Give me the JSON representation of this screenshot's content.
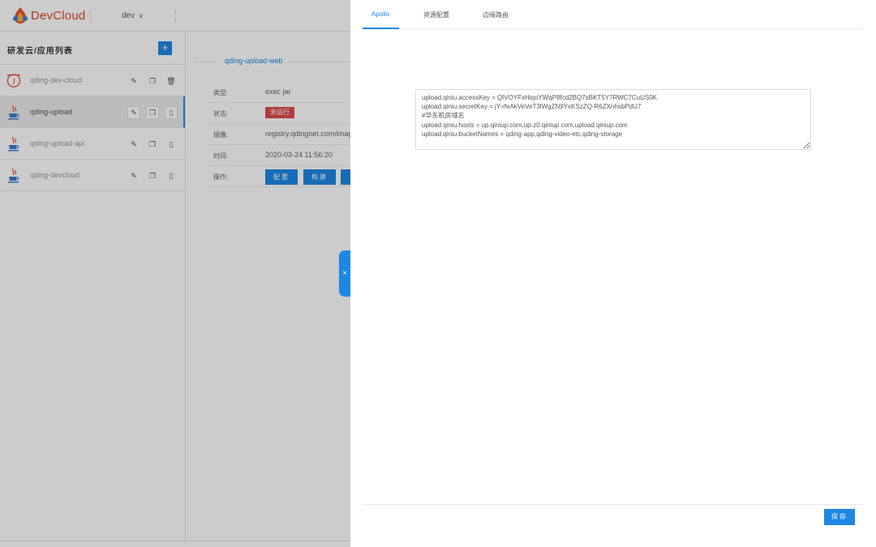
{
  "header": {
    "logo_text": "DevCloud",
    "env_label": "dev",
    "env_chevron": "∨"
  },
  "sidebar": {
    "title": "研发云/应用列表",
    "add_label": "+",
    "items": [
      {
        "name": "qding-dev-cloud",
        "icon": "dev-cloud-app-icon",
        "active": false
      },
      {
        "name": "qding-upload",
        "icon": "java-cup-icon",
        "active": true
      },
      {
        "name": "qding-upload-api",
        "icon": "java-cup-icon",
        "active": false
      },
      {
        "name": "qding-devcloud",
        "icon": "java-cup-icon",
        "active": false
      }
    ]
  },
  "detail": {
    "section_title": "qding-upload-web",
    "rows": [
      {
        "label": "类型:",
        "value": "exec jar"
      },
      {
        "label": "状态:",
        "value": "未运行"
      },
      {
        "label": "镜像:",
        "value": "registry.qdingnet.com/imag"
      },
      {
        "label": "时间:",
        "value": "2020-03-24 11:56:20"
      },
      {
        "label": "操作:",
        "value": ""
      }
    ],
    "buttons": [
      "配置",
      "构建"
    ]
  },
  "drawer": {
    "close_label": "×",
    "tabs": [
      "Apollo",
      "资源配置",
      "边缘路由"
    ],
    "active_tab": "Apollo",
    "config_text": "upload.qiniu.accessKey = QlVOYFxHiqoYWqP8fcd2BQ7sBKT5Y7RWC7CuUS0K\nupload.qiniu.secretKey = jY-rfeAkVeVeT3lWgZN9YxKSzZQ-R6ZXnhsbPdU7\n#华东机房域名\nupload.qiniu.hosts = up.qiniup.com,up-z0.qiniup.com,upload.qiniup.com\nupload.qiniu.bucketNames = qding-app,qding-video-etc,qding-storage",
    "save_label": "保存"
  },
  "colors": {
    "accent": "#1e88e5",
    "danger": "#e04b4b",
    "logo": "#d9482b"
  }
}
